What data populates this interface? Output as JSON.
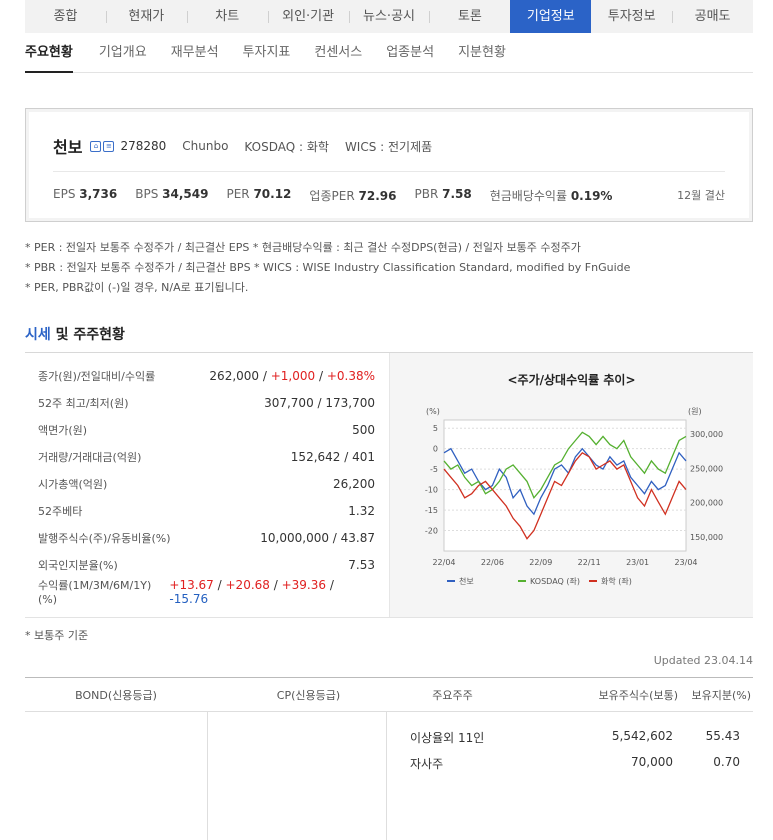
{
  "top_tabs": [
    "종합",
    "현재가",
    "차트",
    "외인·기관",
    "뉴스·공시",
    "토론",
    "기업정보",
    "투자정보",
    "공매도"
  ],
  "top_tab_active": 6,
  "sub_tabs": [
    "주요현황",
    "기업개요",
    "재무분석",
    "투자지표",
    "컨센서스",
    "업종분석",
    "지분현황"
  ],
  "sub_tab_active": 0,
  "corp": {
    "name": "천보",
    "code": "278280",
    "eng_name": "Chunbo",
    "market": "KOSDAQ : 화학",
    "wics": "WICS : 전기제품",
    "metrics": [
      {
        "label": "EPS",
        "value": "3,736"
      },
      {
        "label": "BPS",
        "value": "34,549"
      },
      {
        "label": "PER",
        "value": "70.12"
      },
      {
        "label": "업종PER",
        "value": "72.96"
      },
      {
        "label": "PBR",
        "value": "7.58"
      },
      {
        "label": "현금배당수익률",
        "value": "0.19%"
      }
    ],
    "settlement": "12월 결산"
  },
  "notes": [
    "* PER : 전일자 보통주 수정주가 / 최근결산 EPS * 현금배당수익률 : 최근 결산 수정DPS(현금) / 전일자 보통주 수정주가",
    "* PBR : 전일자 보통주 수정주가 / 최근결산 BPS * WICS : WISE Industry Classification Standard, modified by FnGuide",
    "* PER, PBR값이 (-)일 경우, N/A로 표기됩니다."
  ],
  "section": {
    "accent": "시세",
    "rest": " 및 주주현황"
  },
  "quote": {
    "rows": [
      {
        "label": "종가(원)/전일대비/수익률",
        "plain": "262,000 / ",
        "colored": [
          {
            "t": "+1,000",
            "c": "red"
          },
          {
            "t": " / ",
            "c": ""
          },
          {
            "t": "+0.38%",
            "c": "red"
          }
        ]
      },
      {
        "label": "52주 최고/최저(원)",
        "plain": "307,700 / 173,700",
        "colored": []
      },
      {
        "label": "액면가(원)",
        "plain": "500",
        "colored": []
      },
      {
        "label": "거래량/거래대금(억원)",
        "plain": "152,642 / 401",
        "colored": []
      },
      {
        "label": "시가총액(억원)",
        "plain": "26,200",
        "colored": []
      },
      {
        "label": "52주베타",
        "plain": "1.32",
        "colored": []
      },
      {
        "label": "발행주식수(주)/유동비율(%)",
        "plain": "10,000,000 / 43.87",
        "colored": []
      },
      {
        "label": "외국인지분율(%)",
        "plain": "7.53",
        "colored": []
      },
      {
        "label": "수익률(1M/3M/6M/1Y)(%)",
        "plain": "",
        "colored": [
          {
            "t": "+13.67",
            "c": "red"
          },
          {
            "t": " / ",
            "c": ""
          },
          {
            "t": "+20.68",
            "c": "red"
          },
          {
            "t": " / ",
            "c": ""
          },
          {
            "t": "+39.36",
            "c": "red"
          },
          {
            "t": " / ",
            "c": ""
          },
          {
            "t": "-15.76",
            "c": "blue"
          }
        ]
      }
    ]
  },
  "chart_data": {
    "type": "line",
    "title": "<주가/상대수익률 추이>",
    "left_axis_label": "(%)",
    "right_axis_label": "(원)",
    "left_ticks": [
      "5",
      "0",
      "-5",
      "-10",
      "-15",
      "-20"
    ],
    "left_ylim": [
      -25,
      7
    ],
    "right_ticks": [
      "300,000",
      "250,000",
      "200,000",
      "150,000"
    ],
    "right_ylim": [
      130000,
      320000
    ],
    "x_ticks": [
      "22/04",
      "22/06",
      "22/09",
      "22/11",
      "23/01",
      "23/04"
    ],
    "series": [
      {
        "name": "천보",
        "axis": "left",
        "color": "#3060c0",
        "values": [
          -1,
          0,
          -3,
          -6,
          -5,
          -8,
          -10,
          -9,
          -5,
          -7,
          -12,
          -10,
          -14,
          -16,
          -12,
          -9,
          -5,
          -4,
          -6,
          -2,
          0,
          -2,
          -4,
          -5,
          -2,
          -4,
          -3,
          -7,
          -9,
          -11,
          -8,
          -10,
          -9,
          -5,
          -1,
          -3
        ]
      },
      {
        "name": "KOSDAQ (좌)",
        "axis": "left",
        "color": "#55b030",
        "values": [
          -3,
          -5,
          -4,
          -7,
          -9,
          -8,
          -11,
          -10,
          -8,
          -5,
          -4,
          -6,
          -8,
          -12,
          -10,
          -7,
          -4,
          -3,
          0,
          2,
          4,
          3,
          1,
          3,
          1,
          0,
          2,
          -2,
          -4,
          -6,
          -3,
          -5,
          -6,
          -2,
          2,
          3
        ]
      },
      {
        "name": "화학 (좌)",
        "axis": "left",
        "color": "#d03020",
        "values": [
          -5,
          -7,
          -9,
          -12,
          -11,
          -9,
          -8,
          -10,
          -12,
          -14,
          -17,
          -19,
          -22,
          -20,
          -16,
          -12,
          -8,
          -9,
          -6,
          -3,
          -1,
          -2,
          -5,
          -4,
          -3,
          -5,
          -4,
          -8,
          -12,
          -14,
          -10,
          -13,
          -16,
          -12,
          -8,
          -10
        ]
      }
    ]
  },
  "common_note": "* 보통주 기준",
  "updated": "Updated 23.04.14",
  "bottom": {
    "headers": [
      "BOND(신용등급)",
      "CP(신용등급)",
      "주요주주",
      "보유주식수(보통)",
      "보유지분(%)"
    ],
    "holders": [
      {
        "name": "이상율외 11인",
        "shares": "5,542,602",
        "pct": "55.43"
      },
      {
        "name": "자사주",
        "shares": "70,000",
        "pct": "0.70"
      }
    ]
  }
}
